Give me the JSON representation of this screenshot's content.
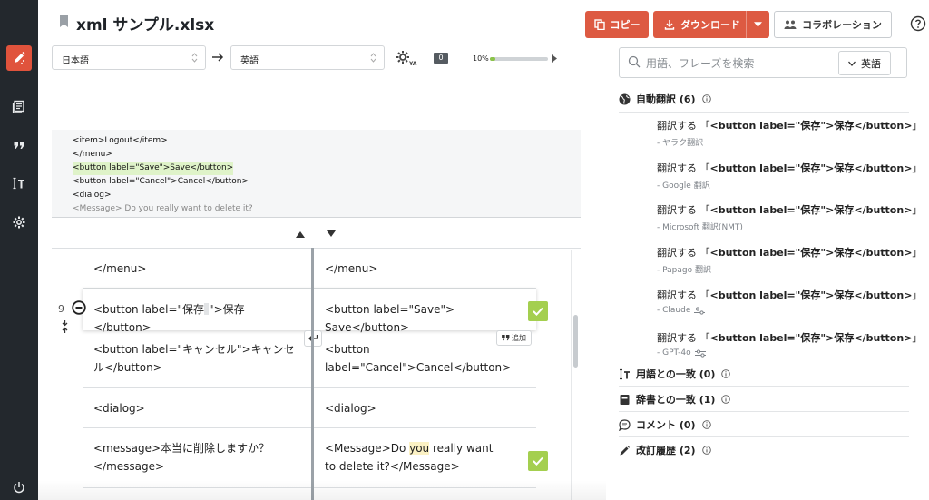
{
  "header": {
    "file_title": "xml サンプル.xlsx",
    "copy_label": "コピー",
    "download_label": "ダウンロード",
    "collab_label": "コラボレーション",
    "accent_color": "#dd5a42"
  },
  "toolbar": {
    "source_language": "日本語",
    "target_language": "英語",
    "badge_count": "0",
    "progress_label": "10%",
    "progress_value": 0.1
  },
  "preview": {
    "lines": [
      "<item>Logout</item>",
      "</menu>",
      "<button label=\"Save\">Save</button>",
      "<button label=\"Cancel\">Cancel</button>",
      "<dialog>",
      "<Message> Do you really want to delete it?"
    ]
  },
  "segments": [
    {
      "source": "</menu>",
      "target": "</menu>"
    },
    {
      "number": "9",
      "source_before": "<button label=\"保存",
      "source_after": "\">保存</button>",
      "target_before": "<button label=\"Save\">",
      "target_after": "Save</button>"
    },
    {
      "source": "<button label=\"キャンセル\">キャンセル</button>",
      "target": "<button label=\"Cancel\">Cancel</button>"
    },
    {
      "source": "<dialog>",
      "target": "<dialog>"
    },
    {
      "source": "<message>本当に削除しますか？</message>",
      "target_before": "<Message>Do ",
      "target_highlight": "you",
      "target_after": " really want to delete it?</Message>"
    }
  ],
  "add_label": "追加",
  "panel": {
    "search_placeholder": "用語、フレーズを検索",
    "search_language": "英語",
    "mt_heading": "自動翻訳 (6)",
    "mt_items": [
      {
        "prefix": "翻訳する 「",
        "text": "<button label=\"保存\">保存</button>",
        "suffix": "」",
        "engine": "- ヤラク翻訳"
      },
      {
        "prefix": "翻訳する 「",
        "text": "<button label=\"保存\">保存</button>",
        "suffix": "」",
        "engine": "- Google 翻訳"
      },
      {
        "prefix": "翻訳する 「",
        "text": "<button label=\"保存\">保存</button>",
        "suffix": "」",
        "engine": "- Microsoft 翻訳(NMT)"
      },
      {
        "prefix": "翻訳する 「",
        "text": "<button label=\"保存\">保存</button>",
        "suffix": "」",
        "engine": "- Papago 翻訳"
      },
      {
        "prefix": "翻訳する 「",
        "text": "<button label=\"保存\">保存</button>",
        "suffix": "」",
        "engine": "- Claude"
      },
      {
        "prefix": "翻訳する 「",
        "text": "<button label=\"保存\">保存</button>",
        "suffix": "」",
        "engine": "- GPT-4o"
      }
    ],
    "term_heading": "用語との一致 (0)",
    "dict_heading": "辞書との一致 (1)",
    "comment_heading": "コメント (0)",
    "history_heading": "改訂履歴 (2)"
  }
}
